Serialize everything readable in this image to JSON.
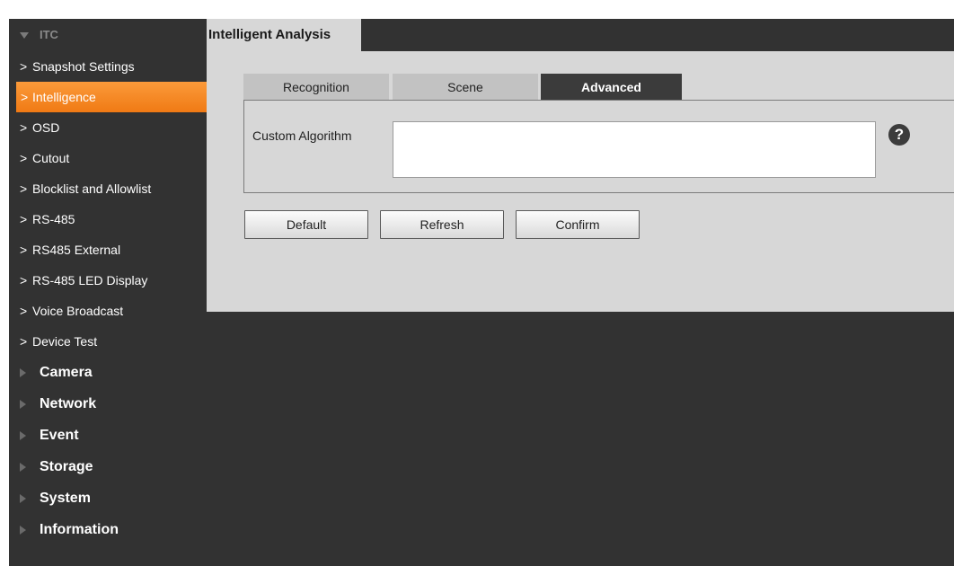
{
  "sidebar": {
    "itc": {
      "label": "ITC"
    },
    "items": [
      {
        "label": "Snapshot Settings"
      },
      {
        "label": "Intelligence"
      },
      {
        "label": "OSD"
      },
      {
        "label": "Cutout"
      },
      {
        "label": "Blocklist and Allowlist"
      },
      {
        "label": "RS-485"
      },
      {
        "label": "RS485 External"
      },
      {
        "label": "RS-485 LED Display"
      },
      {
        "label": "Voice Broadcast"
      },
      {
        "label": "Device Test"
      }
    ],
    "active_item": "Intelligence",
    "sections": [
      {
        "label": "Camera"
      },
      {
        "label": "Network"
      },
      {
        "label": "Event"
      },
      {
        "label": "Storage"
      },
      {
        "label": "System"
      },
      {
        "label": "Information"
      }
    ]
  },
  "panel": {
    "title": "Intelligent Analysis",
    "tabs": [
      {
        "label": "Recognition"
      },
      {
        "label": "Scene"
      },
      {
        "label": "Advanced"
      }
    ],
    "active_tab": "Advanced",
    "custom_algorithm": {
      "label": "Custom Algorithm",
      "value": ""
    },
    "help_icon": "question-circle-icon",
    "buttons": {
      "default": "Default",
      "refresh": "Refresh",
      "confirm": "Confirm"
    }
  },
  "colors": {
    "background": "#323232",
    "panel": "#d7d7d7",
    "accent": "#f58a25",
    "active_tab": "#3b3b3b"
  }
}
